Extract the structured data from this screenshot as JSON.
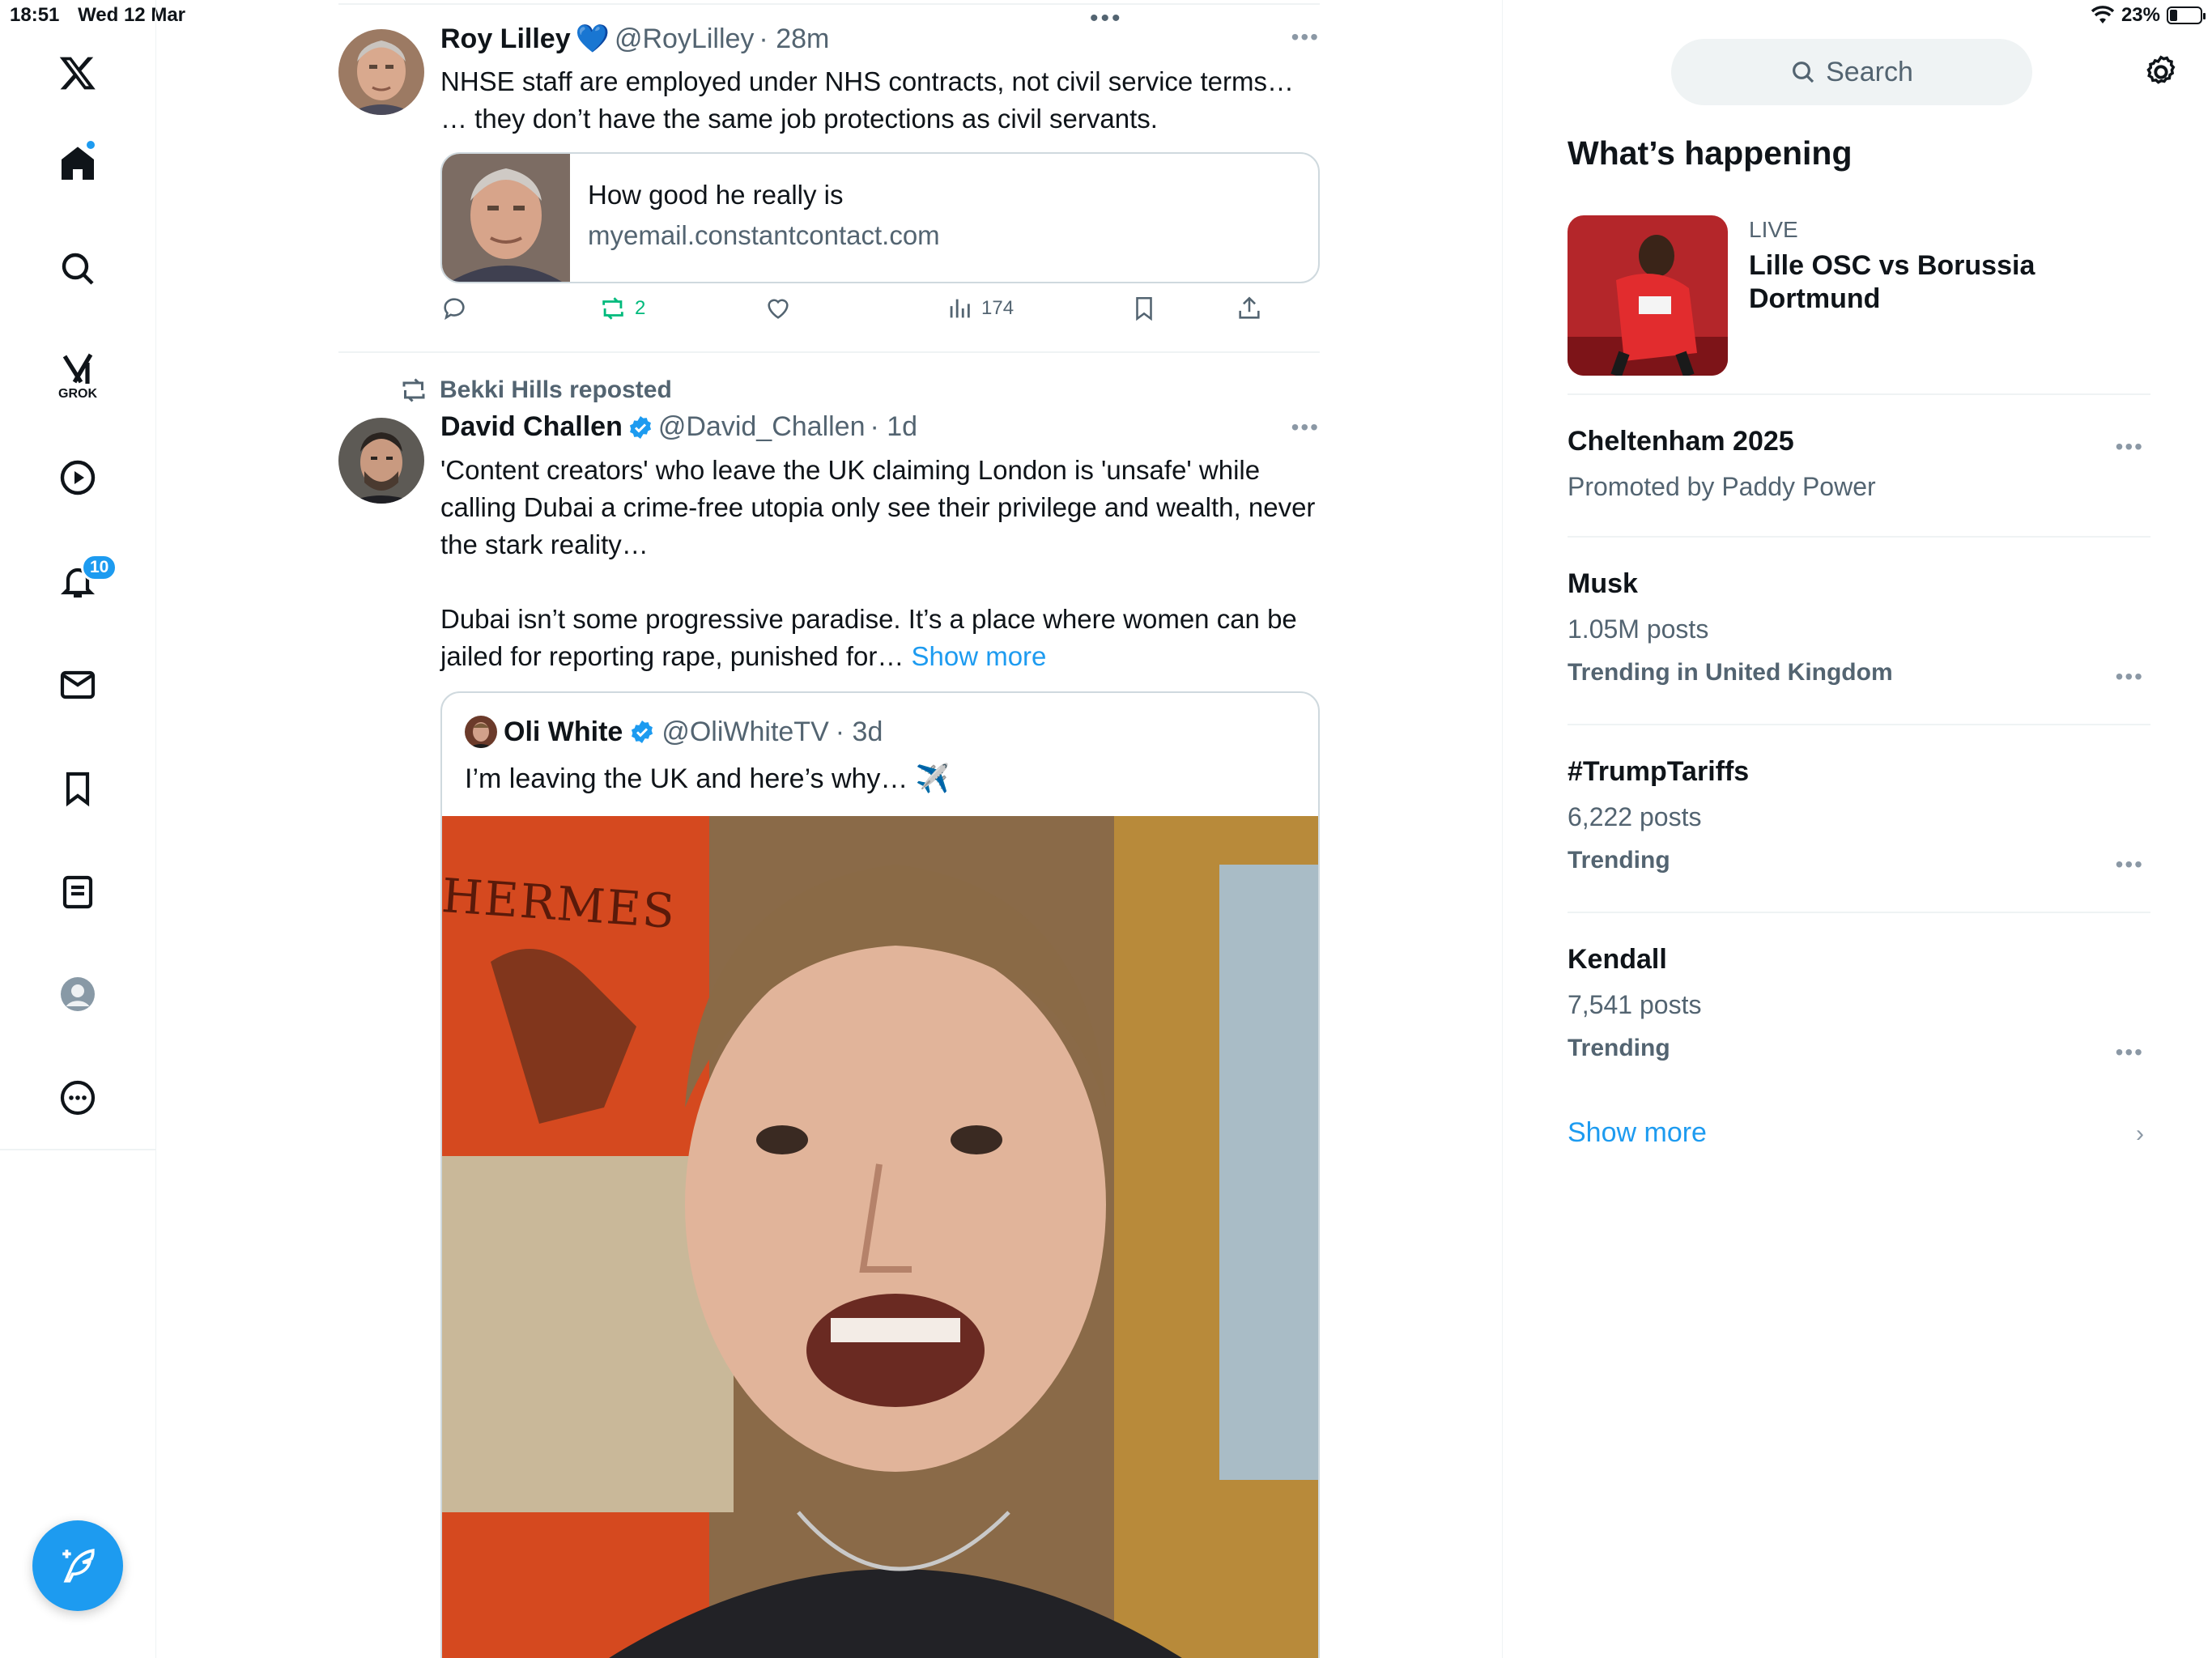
{
  "status_bar": {
    "time": "18:51",
    "date": "Wed 12 Mar",
    "battery": "23%"
  },
  "nav": {
    "grok_label": "GROK",
    "notifications_count": "10"
  },
  "tweets": [
    {
      "name": "Roy Lilley",
      "emoji": "💙",
      "handle": "@RoyLilley",
      "time": "· 28m",
      "text": "NHSE staff are employed under NHS contracts, not civil service terms…\n… they don’t have the same job protections as civil servants.",
      "link_card": {
        "title": "How good he really is",
        "domain": "myemail.constantcontact.com"
      },
      "actions": {
        "reposts": "2",
        "views": "174"
      }
    },
    {
      "reposted_by": "Bekki Hills reposted",
      "name": "David Challen",
      "handle": "@David_Challen",
      "time": "· 1d",
      "text": "'Content creators' who leave the UK claiming London is 'unsafe' while calling Dubai a crime-free utopia only see their privilege and wealth, never the stark reality…\n\nDubai isn’t some progressive paradise. It’s a place where women can be jailed for reporting rape, punished for… ",
      "show_more": "Show more",
      "quote": {
        "name": "Oli White",
        "handle": "@OliWhiteTV",
        "time": "· 3d",
        "text": "I’m leaving the UK and here’s why… ✈️",
        "media_sign": "HERMES"
      }
    }
  ],
  "sidebar": {
    "search_placeholder": "Search",
    "section_title": "What’s happening",
    "live_event": {
      "label": "LIVE",
      "title": "Lille OSC vs Borussia Dortmund"
    },
    "trends": [
      {
        "title": "Cheltenham 2025",
        "subtitle": "Promoted by Paddy Power",
        "category": ""
      },
      {
        "title": "Musk",
        "subtitle": "1.05M posts",
        "category": "Trending in United Kingdom"
      },
      {
        "title": "#TrumpTariffs",
        "subtitle": "6,222 posts",
        "category": "Trending"
      },
      {
        "title": "Kendall",
        "subtitle": "7,541 posts",
        "category": "Trending"
      }
    ],
    "show_more": "Show more"
  },
  "colors": {
    "accent": "#1d9bf0",
    "repost_green": "#00ba7c",
    "secondary_text": "#536471"
  }
}
